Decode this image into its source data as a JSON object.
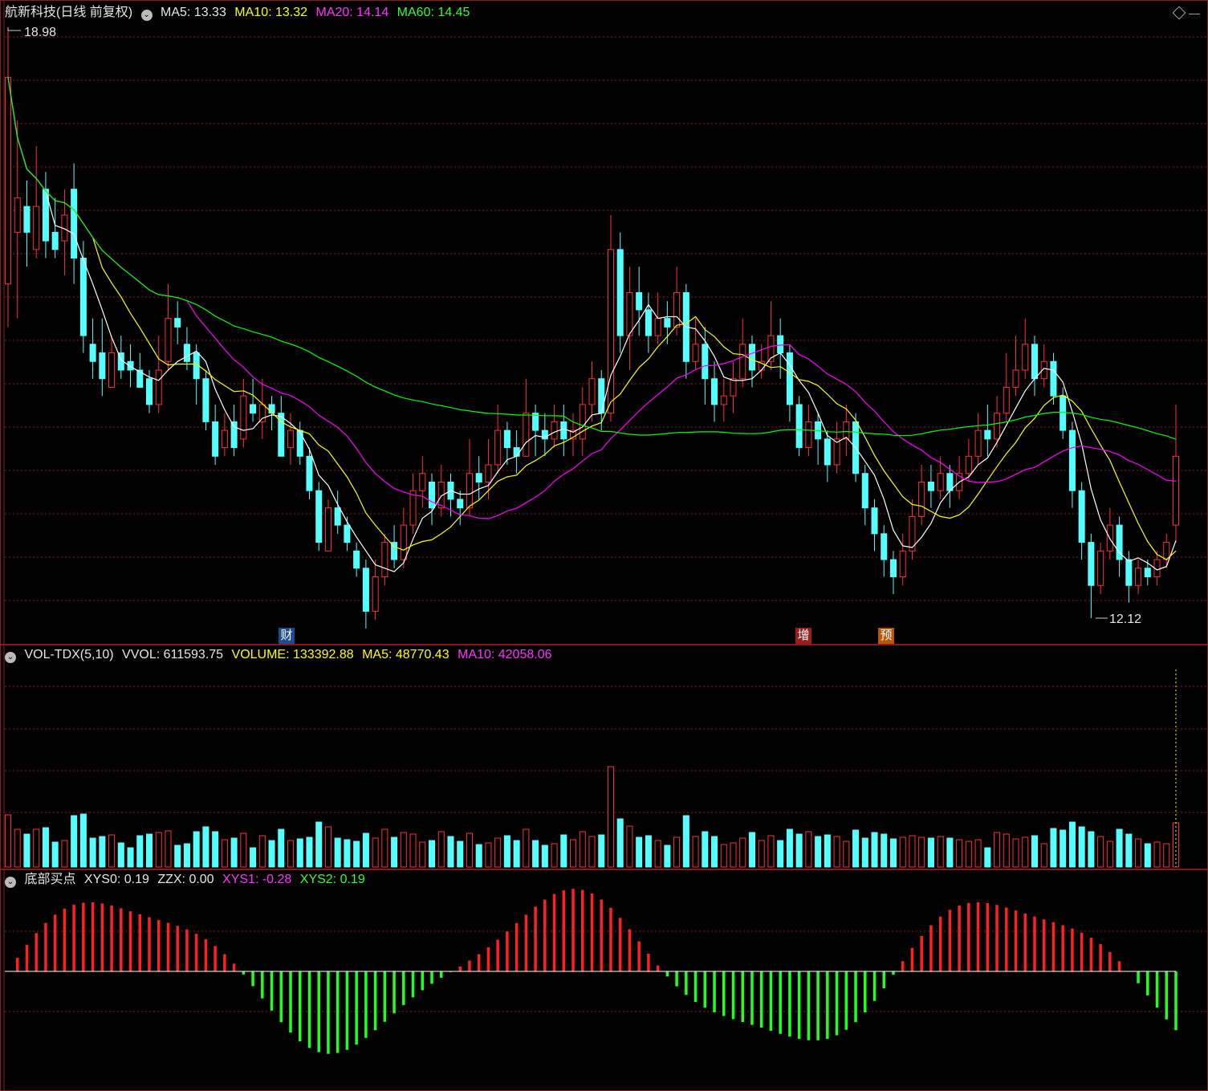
{
  "main": {
    "title": "航新科技(日线 前复权)",
    "ma5": "MA5: 13.33",
    "ma10": "MA10: 13.32",
    "ma20": "MA20: 14.14",
    "ma60": "MA60: 14.45",
    "high_label": "18.98",
    "low_label": "12.12",
    "tags": [
      "财",
      "增",
      "预"
    ]
  },
  "vol": {
    "name": "VOL-TDX(5,10)",
    "vvol": "VVOL: 611593.75",
    "volume": "VOLUME: 133392.88",
    "ma5": "MA5: 48770.43",
    "ma10": "MA10: 42058.06"
  },
  "ind": {
    "name": "底部买点",
    "xys0": "XYS0: 0.19",
    "zzx": "ZZX: 0.00",
    "xys1": "XYS1: -0.28",
    "xys2": "XYS2: 0.19"
  },
  "colors": {
    "up": "#ff3232",
    "down": "#54ffff",
    "ma5": "#ffffff",
    "ma10": "#ffff00",
    "ma20": "#ff00ff",
    "ma60": "#00ff00",
    "grid": "#8b1c1c"
  },
  "chart_data": {
    "type": "candlestick",
    "price_range": [
      12.12,
      18.98
    ],
    "candles": [
      [
        16.0,
        18.4,
        18.98,
        15.5
      ],
      [
        16.6,
        17.0,
        17.9,
        15.6
      ],
      [
        16.9,
        16.6,
        17.2,
        16.2
      ],
      [
        16.4,
        16.9,
        17.6,
        16.3
      ],
      [
        17.1,
        16.5,
        17.3,
        16.3
      ],
      [
        16.6,
        16.4,
        17.0,
        16.3
      ],
      [
        16.5,
        16.8,
        17.1,
        16.1
      ],
      [
        17.1,
        16.3,
        17.4,
        16.0
      ],
      [
        16.3,
        15.4,
        16.5,
        15.2
      ],
      [
        15.3,
        15.1,
        15.6,
        14.9
      ],
      [
        15.2,
        14.9,
        15.6,
        14.7
      ],
      [
        14.8,
        15.2,
        15.4,
        14.8
      ],
      [
        15.2,
        15.0,
        15.4,
        14.9
      ],
      [
        15.1,
        15.0,
        15.3,
        14.8
      ],
      [
        15.0,
        14.8,
        15.2,
        14.8
      ],
      [
        14.9,
        14.6,
        15.0,
        14.5
      ],
      [
        14.6,
        15.0,
        15.4,
        14.5
      ],
      [
        15.1,
        15.6,
        16.0,
        15.0
      ],
      [
        15.6,
        15.5,
        15.8,
        15.3
      ],
      [
        15.3,
        15.1,
        15.5,
        15.0
      ],
      [
        15.2,
        14.9,
        15.3,
        14.6
      ],
      [
        14.9,
        14.4,
        15.0,
        14.3
      ],
      [
        14.4,
        14.0,
        14.6,
        13.9
      ],
      [
        14.1,
        14.3,
        14.5,
        14.0
      ],
      [
        14.4,
        14.1,
        14.6,
        14.0
      ],
      [
        14.2,
        14.7,
        14.9,
        14.1
      ],
      [
        14.6,
        14.5,
        14.9,
        14.4
      ],
      [
        14.4,
        14.6,
        14.9,
        14.2
      ],
      [
        14.6,
        14.5,
        14.7,
        14.3
      ],
      [
        14.5,
        14.0,
        14.7,
        14.0
      ],
      [
        14.1,
        14.3,
        14.5,
        13.9
      ],
      [
        14.3,
        14.0,
        14.4,
        13.9
      ],
      [
        14.0,
        13.6,
        14.1,
        13.5
      ],
      [
        13.6,
        13.0,
        13.7,
        12.9
      ],
      [
        12.9,
        13.4,
        13.5,
        12.9
      ],
      [
        13.4,
        13.2,
        13.6,
        13.1
      ],
      [
        13.2,
        13.0,
        13.3,
        12.9
      ],
      [
        12.9,
        12.7,
        13.0,
        12.6
      ],
      [
        12.7,
        12.2,
        12.8,
        12.0
      ],
      [
        12.2,
        12.6,
        12.8,
        12.1
      ],
      [
        12.6,
        13.0,
        13.1,
        12.5
      ],
      [
        13.0,
        12.8,
        13.2,
        12.7
      ],
      [
        12.8,
        13.2,
        13.4,
        12.7
      ],
      [
        13.2,
        13.6,
        13.8,
        13.1
      ],
      [
        13.6,
        13.8,
        14.0,
        13.4
      ],
      [
        13.7,
        13.4,
        13.8,
        13.2
      ],
      [
        13.4,
        13.7,
        13.9,
        13.3
      ],
      [
        13.7,
        13.5,
        13.8,
        13.3
      ],
      [
        13.5,
        13.4,
        13.6,
        13.2
      ],
      [
        13.4,
        13.8,
        14.2,
        13.3
      ],
      [
        13.8,
        13.7,
        14.0,
        13.5
      ],
      [
        13.7,
        13.9,
        14.2,
        13.5
      ],
      [
        13.9,
        14.3,
        14.6,
        13.8
      ],
      [
        14.3,
        14.1,
        14.4,
        13.9
      ],
      [
        14.1,
        14.0,
        14.3,
        13.8
      ],
      [
        14.0,
        14.5,
        14.9,
        14.0
      ],
      [
        14.5,
        14.3,
        14.6,
        14.0
      ],
      [
        14.3,
        14.2,
        14.5,
        14.0
      ],
      [
        14.2,
        14.4,
        14.6,
        14.1
      ],
      [
        14.4,
        14.2,
        14.6,
        14.0
      ],
      [
        14.2,
        14.3,
        14.5,
        14.0
      ],
      [
        14.2,
        14.6,
        14.8,
        14.0
      ],
      [
        14.6,
        14.9,
        15.1,
        14.4
      ],
      [
        14.9,
        14.5,
        15.0,
        14.3
      ],
      [
        14.5,
        16.4,
        16.8,
        14.4
      ],
      [
        16.4,
        15.4,
        16.6,
        15.2
      ],
      [
        15.4,
        15.9,
        16.2,
        15.0
      ],
      [
        15.9,
        15.7,
        16.2,
        15.4
      ],
      [
        15.7,
        15.4,
        15.9,
        15.2
      ],
      [
        15.4,
        15.6,
        15.9,
        15.3
      ],
      [
        15.6,
        15.5,
        15.8,
        15.3
      ],
      [
        15.5,
        15.9,
        16.2,
        15.4
      ],
      [
        15.9,
        15.1,
        16.0,
        14.9
      ],
      [
        15.1,
        15.3,
        15.6,
        15.0
      ],
      [
        15.3,
        14.9,
        15.5,
        14.6
      ],
      [
        14.9,
        14.6,
        15.1,
        14.4
      ],
      [
        14.6,
        14.7,
        14.9,
        14.4
      ],
      [
        14.7,
        14.9,
        15.1,
        14.5
      ],
      [
        14.9,
        15.3,
        15.6,
        14.8
      ],
      [
        15.3,
        15.0,
        15.4,
        14.8
      ],
      [
        15.0,
        15.1,
        15.3,
        14.9
      ],
      [
        15.1,
        15.4,
        15.8,
        15.0
      ],
      [
        15.4,
        15.2,
        15.6,
        14.9
      ],
      [
        15.2,
        14.6,
        15.3,
        14.4
      ],
      [
        14.6,
        14.1,
        14.7,
        14.0
      ],
      [
        14.1,
        14.4,
        14.6,
        14.0
      ],
      [
        14.4,
        14.2,
        14.5,
        13.9
      ],
      [
        14.2,
        13.9,
        14.3,
        13.7
      ],
      [
        13.9,
        14.2,
        14.4,
        13.8
      ],
      [
        14.2,
        14.4,
        14.6,
        14.0
      ],
      [
        14.4,
        13.8,
        14.5,
        13.7
      ],
      [
        13.8,
        13.4,
        13.9,
        13.2
      ],
      [
        13.4,
        13.1,
        13.5,
        12.9
      ],
      [
        13.1,
        12.8,
        13.2,
        12.6
      ],
      [
        12.8,
        12.6,
        12.9,
        12.4
      ],
      [
        12.6,
        12.9,
        13.1,
        12.5
      ],
      [
        12.9,
        13.3,
        13.5,
        12.8
      ],
      [
        13.3,
        13.7,
        13.9,
        13.2
      ],
      [
        13.7,
        13.6,
        13.9,
        13.4
      ],
      [
        13.6,
        13.8,
        14.0,
        13.5
      ],
      [
        13.8,
        13.6,
        13.9,
        13.4
      ],
      [
        13.6,
        13.8,
        14.0,
        13.5
      ],
      [
        13.8,
        14.0,
        14.2,
        13.7
      ],
      [
        14.0,
        14.3,
        14.5,
        13.9
      ],
      [
        14.3,
        14.2,
        14.6,
        14.0
      ],
      [
        14.2,
        14.5,
        14.7,
        14.1
      ],
      [
        14.5,
        14.8,
        15.2,
        14.4
      ],
      [
        14.8,
        15.0,
        15.4,
        14.7
      ],
      [
        15.0,
        15.3,
        15.6,
        14.9
      ],
      [
        15.3,
        14.9,
        15.4,
        14.7
      ],
      [
        14.9,
        15.1,
        15.3,
        14.8
      ],
      [
        15.1,
        14.7,
        15.2,
        14.6
      ],
      [
        14.7,
        14.3,
        14.8,
        14.2
      ],
      [
        14.3,
        13.6,
        14.4,
        13.4
      ],
      [
        13.6,
        13.0,
        13.7,
        12.8
      ],
      [
        13.0,
        12.5,
        13.1,
        12.12
      ],
      [
        12.5,
        12.9,
        13.0,
        12.4
      ],
      [
        12.9,
        13.2,
        13.4,
        12.8
      ],
      [
        13.2,
        12.8,
        13.3,
        12.6
      ],
      [
        12.8,
        12.5,
        12.9,
        12.3
      ],
      [
        12.5,
        12.7,
        12.8,
        12.4
      ],
      [
        12.7,
        12.6,
        12.8,
        12.5
      ],
      [
        12.6,
        12.8,
        12.9,
        12.5
      ],
      [
        12.8,
        13.0,
        13.1,
        12.7
      ],
      [
        13.2,
        14.0,
        14.6,
        13.0
      ]
    ]
  }
}
